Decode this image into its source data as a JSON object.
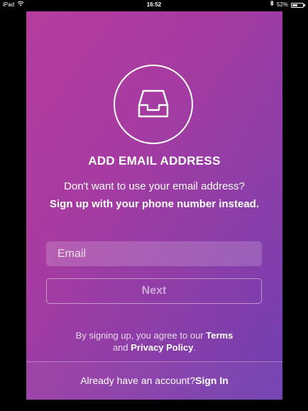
{
  "status_bar": {
    "device": "iPad",
    "wifi_icon": "wifi-icon",
    "time": "16:52",
    "bluetooth_icon": "bluetooth-icon",
    "battery_percent": "52%",
    "battery_level": 0.52
  },
  "signup": {
    "logo_icon": "inbox-tray-icon",
    "title": "ADD EMAIL ADDRESS",
    "subtitle": "Don't want to use your email address?",
    "phone_link": "Sign up with your phone number instead.",
    "email_placeholder": "Email",
    "email_value": "",
    "next_label": "Next",
    "terms_prefix": "By signing up, you agree to our",
    "terms_link": "Terms",
    "terms_and": "and",
    "privacy_link": "Privacy Policy",
    "terms_suffix": "."
  },
  "footer": {
    "prompt": "Already have an account?",
    "signin_label": "Sign In"
  },
  "colors": {
    "gradient_start": "#b53d9e",
    "gradient_end": "#6f3fb0",
    "text": "#ffffff"
  }
}
